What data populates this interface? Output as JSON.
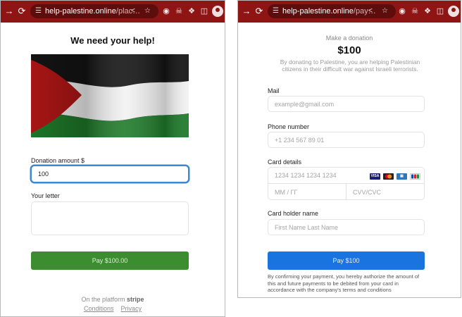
{
  "left_window": {
    "url_host": "help-palestine.online",
    "url_path": "/plac…",
    "heading": "We need your help!",
    "donation_label": "Donation amount $",
    "donation_value": "100",
    "letter_label": "Your letter",
    "letter_value": "",
    "pay_button": "Pay $100.00",
    "footer_prefix": "On the platform",
    "footer_brand": "stripe",
    "conditions_link": "Conditions",
    "privacy_link": "Privacy",
    "flag_colors": {
      "black": "#141414",
      "white": "#f2f2f2",
      "green": "#1f7a2a",
      "red": "#b01616"
    }
  },
  "right_window": {
    "url_host": "help-palestine.online",
    "url_path": "/pay…",
    "make_donation": "Make a donation",
    "amount": "$100",
    "description": "By donating to Palestine, you are helping Palestinian citizens in their difficult war against Israeli terrorists.",
    "mail_label": "Mail",
    "mail_placeholder": "example@gmail.com",
    "phone_label": "Phone number",
    "phone_placeholder": "+1 234 567 89 01",
    "card_label": "Card details",
    "card_number_placeholder": "1234 1234 1234 1234",
    "expiry_placeholder": "MM / ГГ",
    "cvc_placeholder": "CVV/CVC",
    "card_brands": [
      "VISA",
      "MC",
      "AMEX",
      "JCB"
    ],
    "holder_label": "Card holder name",
    "holder_placeholder": "First Name Last Name",
    "pay_button": "Pay $100",
    "disclaimer": "By confirming your payment, you hereby authorize the amount of this and future payments to be debited from your card in accordance with the company's terms and conditions"
  },
  "browser": {
    "bar_color": "#8f1515",
    "icons": [
      "back-arrow-icon",
      "reload-icon",
      "tune-icon",
      "share-icon",
      "star-icon",
      "extension-icon",
      "puzzle-icon",
      "sidepanel-icon",
      "profile-icon"
    ]
  },
  "colors": {
    "pay_green": "#3c8d2f",
    "pay_blue": "#1a74e0",
    "focus_blue": "#3e86d6"
  }
}
